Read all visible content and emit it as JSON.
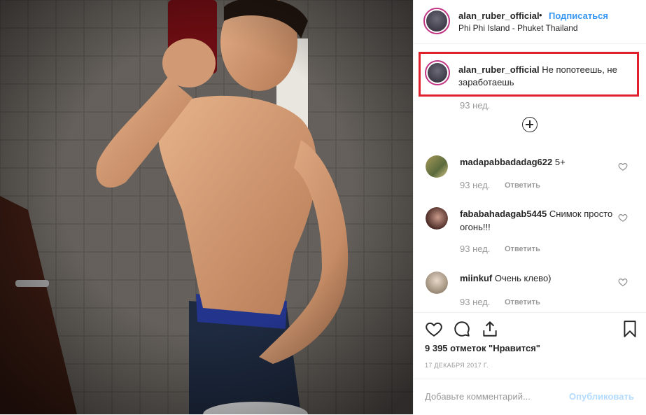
{
  "post": {
    "username": "alan_ruber_official",
    "separator": "•",
    "follow_label": "Подписаться",
    "location": "Phi Phi Island - Phuket Thailand"
  },
  "caption": {
    "username": "alan_ruber_official",
    "text": "Не попотеешь, не заработаешь",
    "time": "93 нед."
  },
  "comments": [
    {
      "username": "madapabbadadag622",
      "text": "5+",
      "time": "93 нед.",
      "reply_label": "Ответить"
    },
    {
      "username": "fababahadagab5445",
      "text": "Снимок просто огонь!!!",
      "time": "93 нед.",
      "reply_label": "Ответить"
    },
    {
      "username": "miinkuf",
      "text": "Очень клево)",
      "time": "93 нед.",
      "reply_label": "Ответить"
    }
  ],
  "actions": {
    "like_icon": "heart-icon",
    "comment_icon": "comment-icon",
    "share_icon": "share-icon",
    "save_icon": "bookmark-icon"
  },
  "likes_text": "9 395 отметок \"Нравится\"",
  "date": "17 ДЕКАБРЯ 2017 Г.",
  "add_comment": {
    "placeholder": "Добавьте комментарий...",
    "publish_label": "Опубликовать"
  },
  "colors": {
    "follow": "#3897f0",
    "highlight_border": "#e0202c",
    "muted": "#999999",
    "publish_disabled": "#b3dbff"
  }
}
